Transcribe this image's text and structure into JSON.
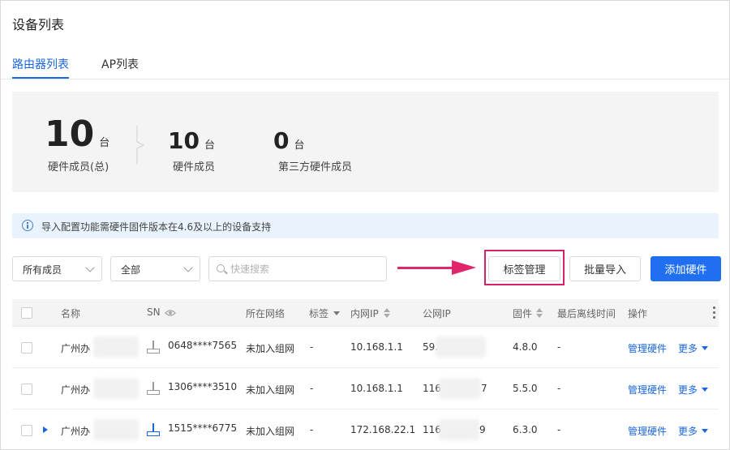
{
  "page": {
    "title": "设备列表"
  },
  "tabs": [
    {
      "label": "路由器列表",
      "active": true
    },
    {
      "label": "AP列表",
      "active": false
    }
  ],
  "stats": [
    {
      "value": "10",
      "unit": "台",
      "label": "硬件成员(总)"
    },
    {
      "value": "10",
      "unit": "台",
      "label": "硬件成员"
    },
    {
      "value": "0",
      "unit": "台",
      "label": "第三方硬件成员"
    }
  ],
  "notice": {
    "text": "导入配置功能需硬件固件版本在4.6及以上的设备支持"
  },
  "filters": {
    "member_select": "所有成员",
    "scope_select": "全部",
    "search_placeholder": "快速搜索"
  },
  "toolbar": {
    "tag_manage_label": "标签管理",
    "batch_import_label": "批量导入",
    "add_hardware_label": "添加硬件"
  },
  "table": {
    "headers": {
      "name": "名称",
      "sn": "SN",
      "network": "所在网络",
      "tag": "标签",
      "lan_ip": "内网IP",
      "wan_ip": "公网IP",
      "firmware": "固件",
      "last_offline": "最后离线时间",
      "actions": "操作"
    },
    "rows": [
      {
        "name": "广州办",
        "sn": "0648****7565",
        "network": "未加入组网",
        "tag": "-",
        "lan_ip": "10.168.1.1",
        "wan_ip": "59.",
        "firmware": "4.8.0",
        "last_offline": "-",
        "manage": "管理硬件",
        "more": "更多",
        "online": false,
        "expandable": false
      },
      {
        "name": "广州办",
        "sn": "1306****3510",
        "network": "未加入组网",
        "tag": "-",
        "lan_ip": "10.168.1.1",
        "wan_ip": "116",
        "wan_ip_tail": "7",
        "firmware": "5.5.0",
        "last_offline": "-",
        "manage": "管理硬件",
        "more": "更多",
        "online": false,
        "expandable": false
      },
      {
        "name": "广州办",
        "sn": "1515****6775",
        "network": "未加入组网",
        "tag": "-",
        "lan_ip": "172.168.22.1",
        "wan_ip": "116",
        "wan_ip_tail": "9",
        "firmware": "6.3.0",
        "last_offline": "-",
        "manage": "管理硬件",
        "more": "更多",
        "online": true,
        "expandable": true
      }
    ]
  },
  "colors": {
    "accent": "#1a66e0",
    "primary_button": "#1f6ff0",
    "annotation": "#e2266b",
    "router_offline": "#999999",
    "router_online": "#1a66e0"
  }
}
